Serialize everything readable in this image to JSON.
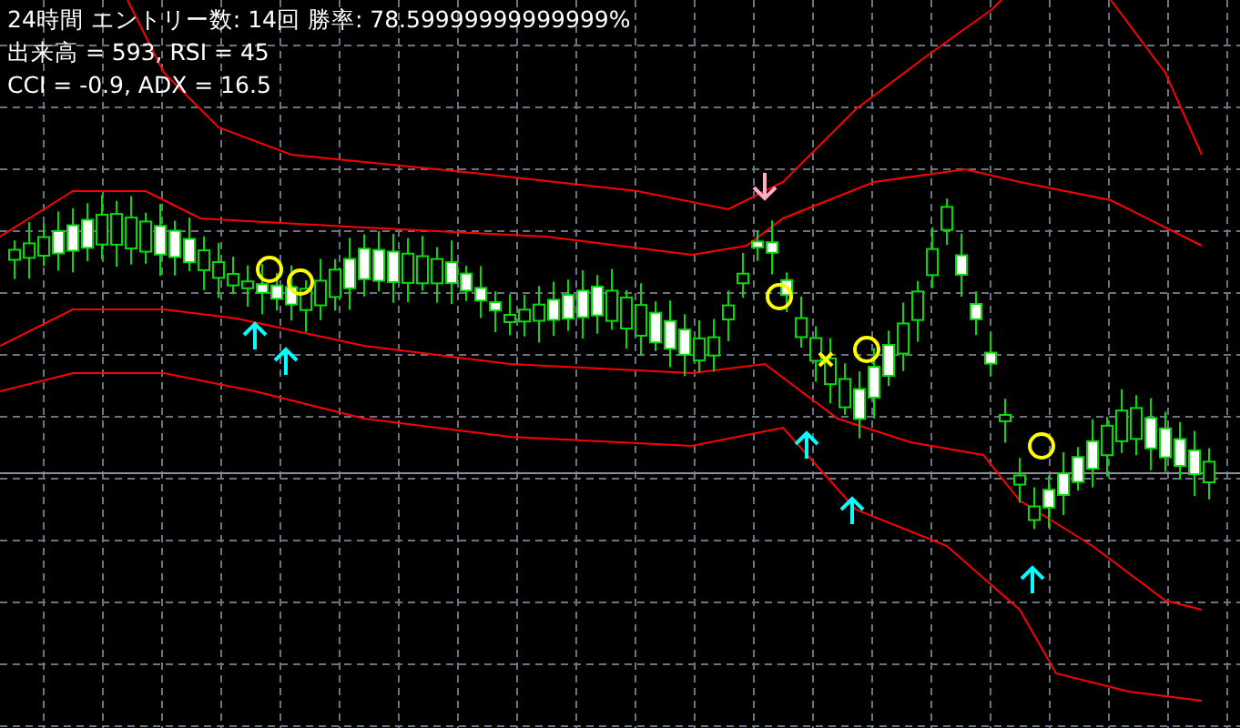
{
  "info_lines": [
    "24時間 エントリー数: 14回 勝率: 78.59999999999999%",
    "出来高 = 593, RSI = 45",
    "CCI = -0.9, ADX = 16.5"
  ]
}
